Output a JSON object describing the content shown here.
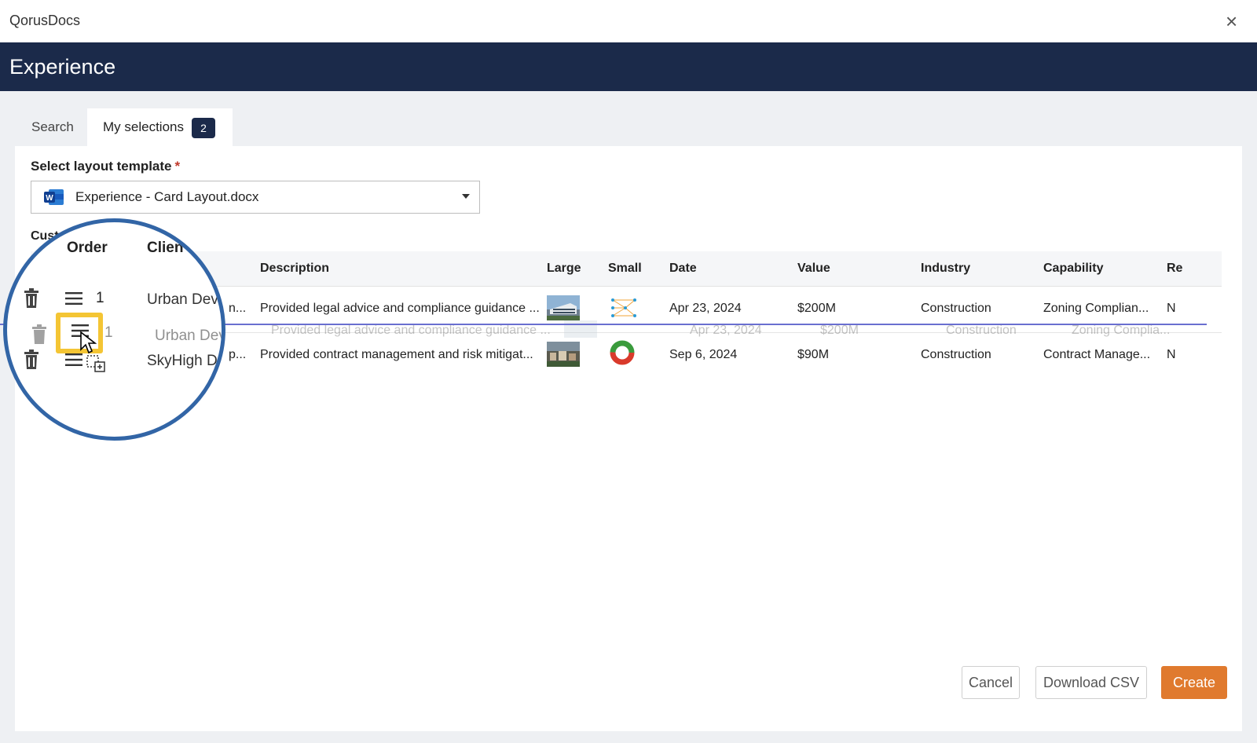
{
  "window": {
    "title": "QorusDocs",
    "close_glyph": "×"
  },
  "header": {
    "title": "Experience"
  },
  "tabs": [
    {
      "label": "Search"
    },
    {
      "label": "My selections",
      "badge": "2",
      "active": true
    }
  ],
  "layout": {
    "label": "Select layout template",
    "required_mark": "*",
    "selected": "Experience - Card Layout.docx",
    "file_icon": "word-icon"
  },
  "section": {
    "label": "Cust"
  },
  "table": {
    "columns": [
      "Order",
      "Clien",
      "Description",
      "Large",
      "Small",
      "Date",
      "Value",
      "Industry",
      "Capability",
      "Re"
    ],
    "rows": [
      {
        "order": "1",
        "client": "Urban Dev",
        "client_tail": "n...",
        "description": "Provided legal advice and compliance guidance ...",
        "large_icon": "building-photo-thumbnail",
        "small_icon": "network-graph-icon",
        "date": "Apr 23, 2024",
        "value": "$200M",
        "industry": "Construction",
        "capability": "Zoning Complian...",
        "re": "N"
      },
      {
        "order": "",
        "client": "SkyHigh D",
        "client_tail": "p...",
        "description": "Provided contract management and risk mitigat...",
        "large_icon": "aerial-city-photo-thumbnail",
        "small_icon": "donut-ring-icon",
        "date": "Sep 6, 2024",
        "value": "$90M",
        "industry": "Construction",
        "capability": "Contract Manage...",
        "re": "N"
      }
    ],
    "drag_ghost": {
      "order": "1",
      "client": "Urban Dev...",
      "description": "Provided legal advice and compliance guidance ...",
      "date": "Apr 23, 2024",
      "value": "$200M",
      "industry": "Construction",
      "capability": "Zoning Complia..."
    }
  },
  "footer": {
    "cancel": "Cancel",
    "download_csv": "Download CSV",
    "create": "Create"
  },
  "colors": {
    "header_bg": "#1b2a4a",
    "create_button": "#e07a2e",
    "zoom_ring": "#3265a6",
    "drop_indicator": "#6a6fd0",
    "drag_highlight": "#f4c534"
  }
}
